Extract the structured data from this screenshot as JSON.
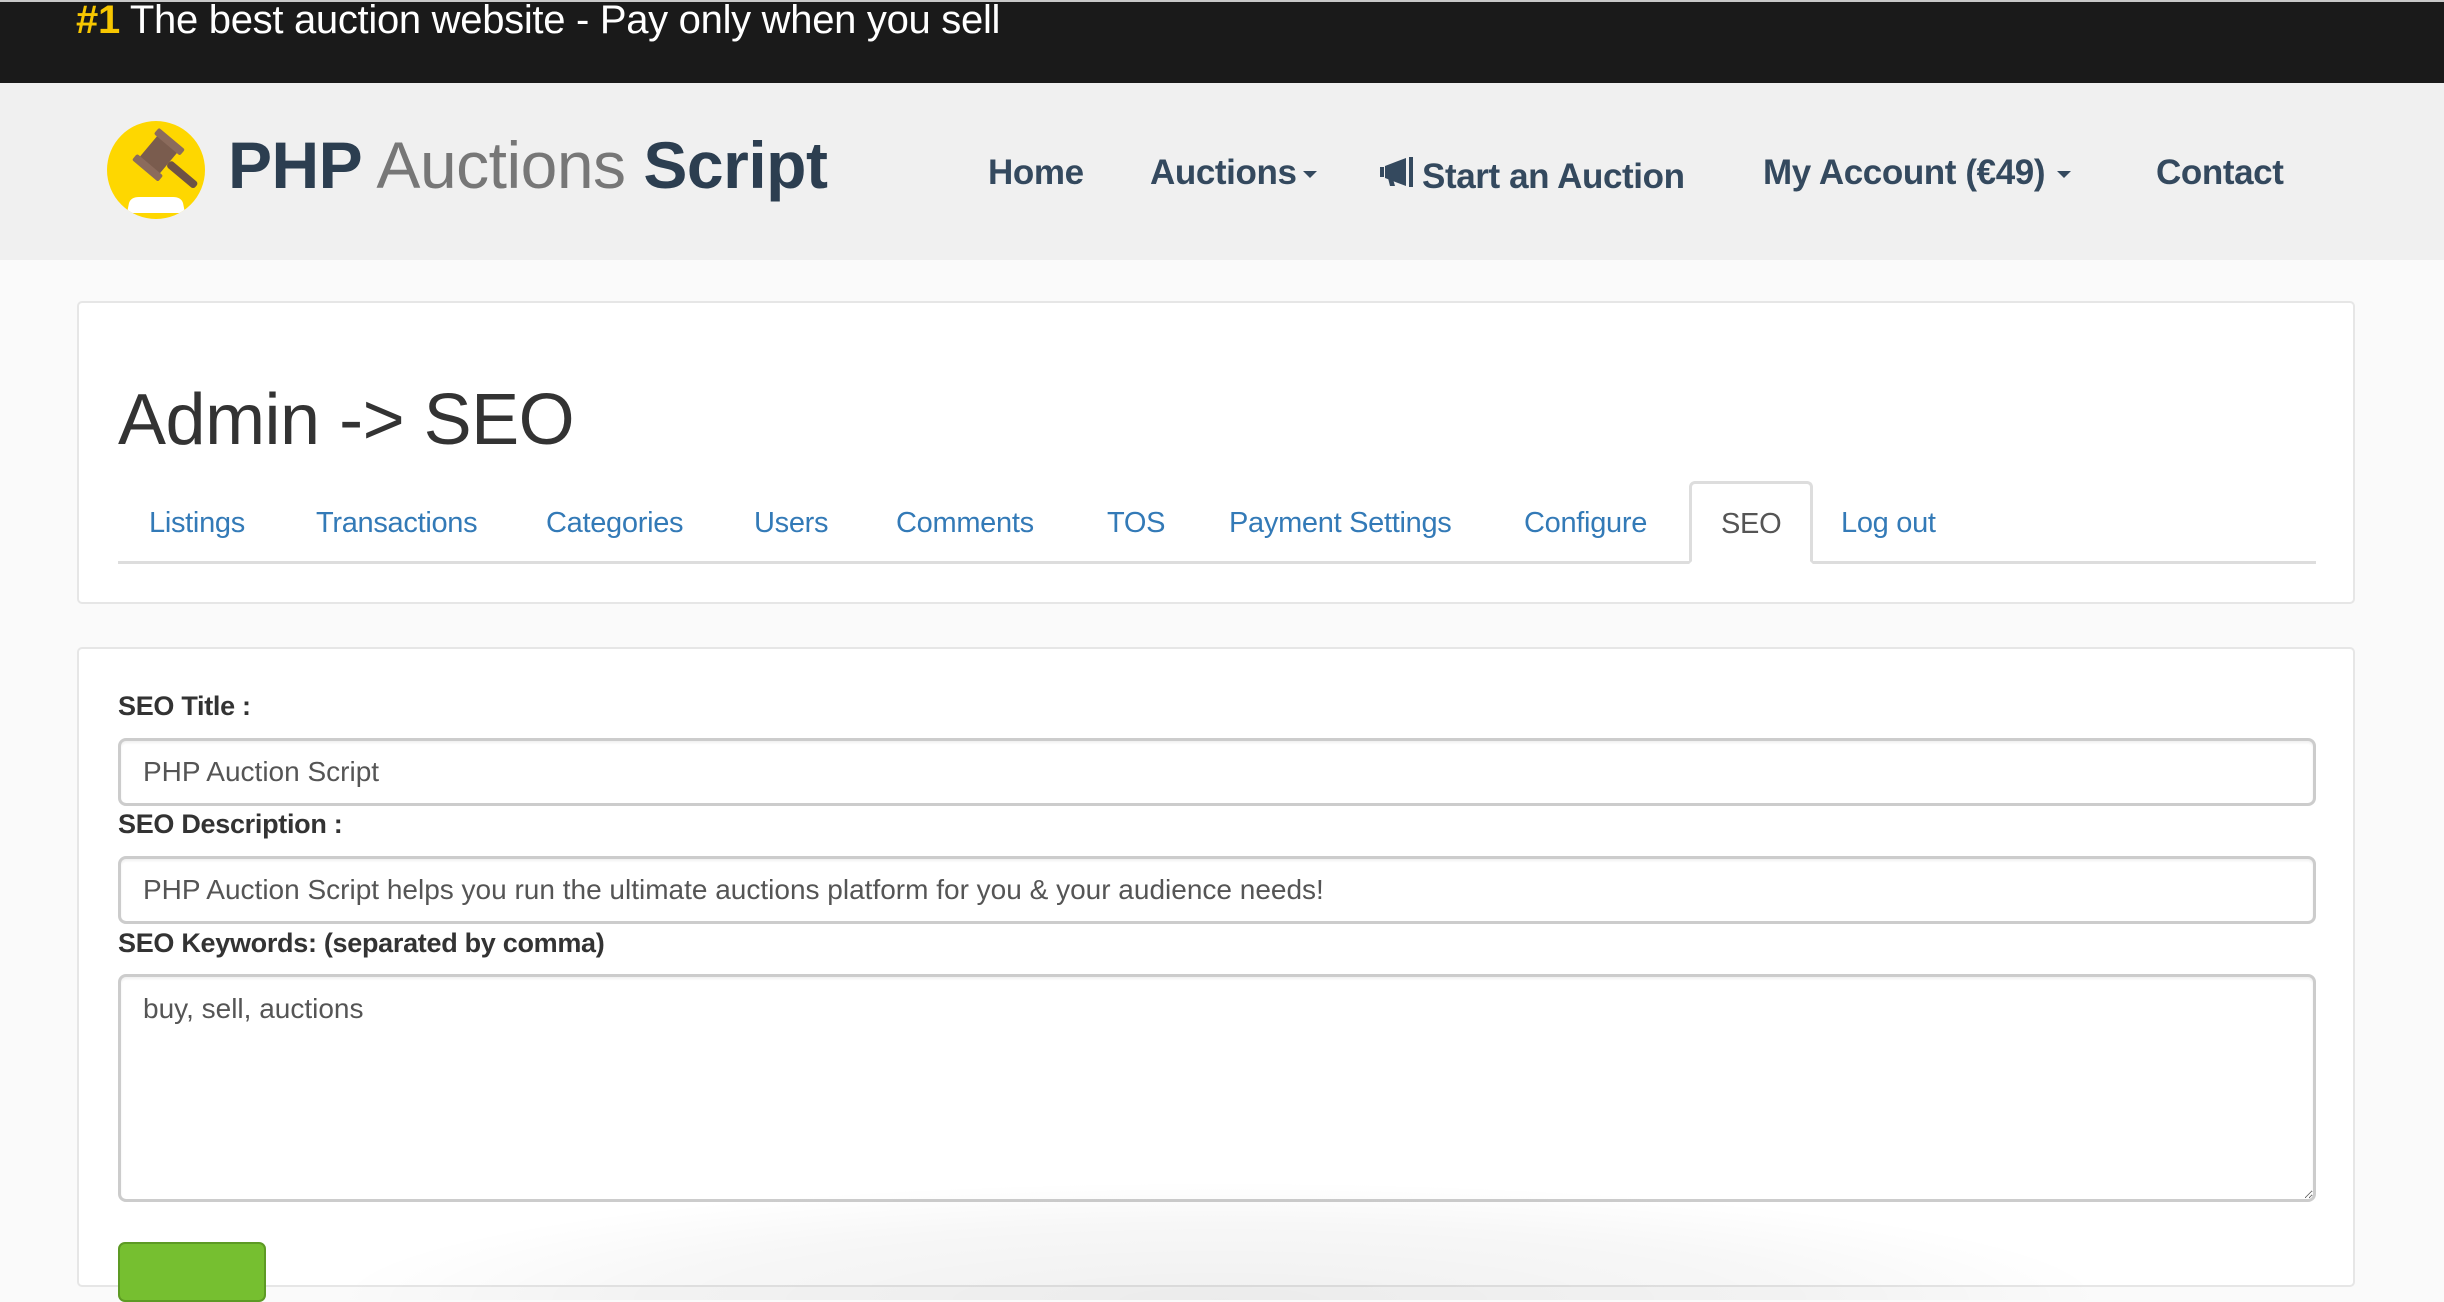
{
  "topbar": {
    "rank": "#1",
    "tagline": "The best auction website - Pay only when you sell"
  },
  "brand": {
    "logo_icon": "gavel-icon",
    "part1": "PHP",
    "part2": "Auctions",
    "part3": "Script"
  },
  "nav": {
    "home": "Home",
    "auctions": "Auctions",
    "start_auction": "Start an Auction",
    "start_auction_icon": "megaphone-icon",
    "my_account": "My Account (€49)",
    "contact": "Contact"
  },
  "admin": {
    "title": "Admin -> SEO",
    "tabs": [
      {
        "label": "Listings",
        "active": false
      },
      {
        "label": "Transactions",
        "active": false
      },
      {
        "label": "Categories",
        "active": false
      },
      {
        "label": "Users",
        "active": false
      },
      {
        "label": "Comments",
        "active": false
      },
      {
        "label": "TOS",
        "active": false
      },
      {
        "label": "Payment Settings",
        "active": false
      },
      {
        "label": "Configure",
        "active": false
      },
      {
        "label": "SEO",
        "active": true
      },
      {
        "label": "Log out",
        "active": false
      }
    ]
  },
  "form": {
    "seo_title_label": "SEO Title :",
    "seo_title_value": "PHP Auction Script",
    "seo_description_label": "SEO Description :",
    "seo_description_value": "PHP Auction Script helps you run the ultimate auctions platform for you & your audience needs!",
    "seo_keywords_label": "SEO Keywords: (separated by comma)",
    "seo_keywords_value": "buy, sell, auctions"
  },
  "colors": {
    "topbar_bg": "#1a1a1a",
    "accent_yellow": "#f7c600",
    "nav_text": "#34495e",
    "link_blue": "#337ab7",
    "save_green": "#76bf30"
  }
}
